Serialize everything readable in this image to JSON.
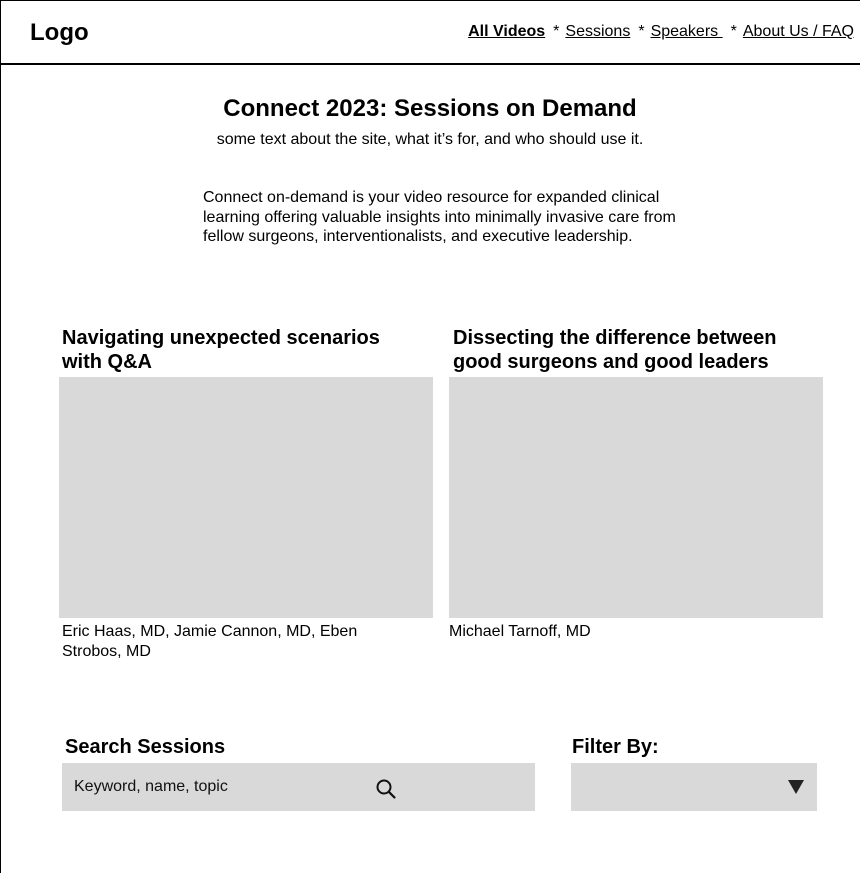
{
  "header": {
    "logo": "Logo",
    "nav": [
      {
        "label": "All Videos",
        "active": true
      },
      {
        "label": "Sessions",
        "active": false
      },
      {
        "label": "Speakers ",
        "active": false
      },
      {
        "label": "About Us / FAQ",
        "active": false
      }
    ],
    "separator": "*"
  },
  "hero": {
    "title": "Connect 2023: Sessions on Demand",
    "subtitle": "some text about the site, what it’s for, and who should use it.",
    "intro": "Connect on-demand is your video resource for expanded clinical learning offering valuable insights into minimally invasive care from fellow surgeons, interventionalists, and executive leadership."
  },
  "featured": [
    {
      "title": "Navigating unexpected scenarios with Q&A",
      "speakers": "Eric Haas, MD, Jamie Cannon, MD, Eben Strobos, MD"
    },
    {
      "title": "Dissecting the difference between good surgeons and good leaders",
      "speakers": "Michael Tarnoff, MD"
    }
  ],
  "search": {
    "label": "Search Sessions",
    "placeholder": "Keyword, name, topic",
    "icon": "search-icon"
  },
  "filter": {
    "label": "Filter By:",
    "selected": "",
    "icon": "chevron-down-icon"
  },
  "colors": {
    "placeholder_gray": "#d9d9d9",
    "text": "#000000"
  }
}
